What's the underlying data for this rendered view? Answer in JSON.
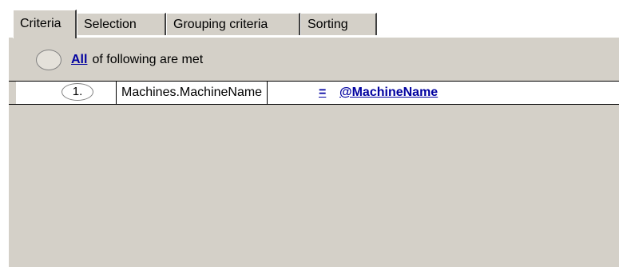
{
  "tabs": [
    {
      "label": "Criteria",
      "active": true
    },
    {
      "label": "Selection",
      "active": false
    },
    {
      "label": "Grouping criteria",
      "active": false
    },
    {
      "label": "Sorting",
      "active": false
    }
  ],
  "criteria": {
    "group_quantifier": "All",
    "group_text": "of following are met",
    "conditions": [
      {
        "number": "1.",
        "field": "Machines.MachineName",
        "operator": "=",
        "value": "@MachineName"
      }
    ]
  },
  "colors": {
    "panel_bg": "#d4d0c8",
    "link": "#0000a0"
  }
}
